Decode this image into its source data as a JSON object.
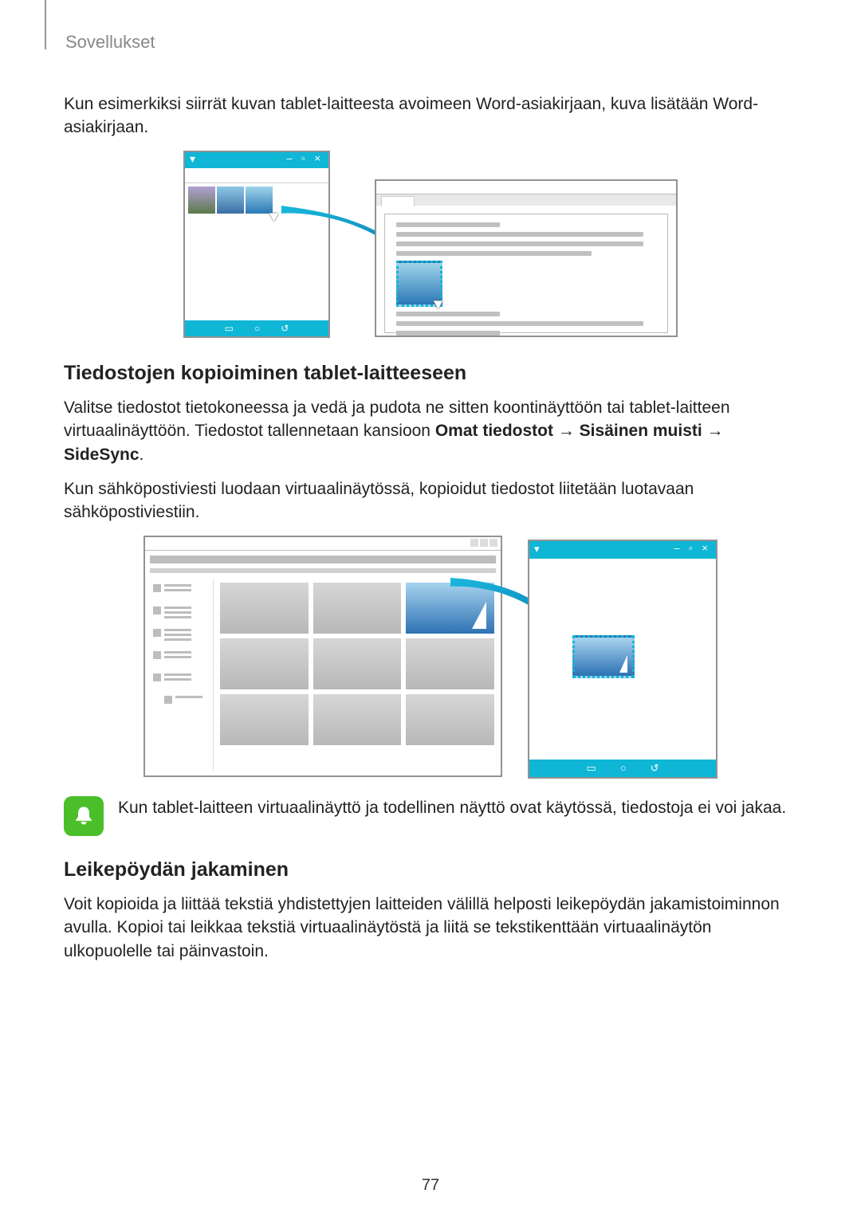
{
  "section": "Sovellukset",
  "intro": "Kun esimerkiksi siirrät kuvan tablet-laitteesta avoimeen Word-asiakirjaan, kuva lisätään Word-asiakirjaan.",
  "h1": "Tiedostojen kopioiminen tablet-laitteeseen",
  "p1a": "Valitse tiedostot tietokoneessa ja vedä ja pudota ne sitten koontinäyttöön tai tablet-laitteen virtuaalinäyttöön. Tiedostot tallennetaan kansioon ",
  "path1": "Omat tiedostot",
  "path2": "Sisäinen muisti",
  "path3": "SideSync",
  "p2": "Kun sähköpostiviesti luodaan virtuaalinäytössä, kopioidut tiedostot liitetään luotavaan sähköpostiviestiin.",
  "note": "Kun tablet-laitteen virtuaalinäyttö ja todellinen näyttö ovat käytössä, tiedostoja ei voi jakaa.",
  "h2": "Leikepöydän jakaminen",
  "p3": "Voit kopioida ja liittää tekstiä yhdistettyjen laitteiden välillä helposti leikepöydän jakamistoiminnon avulla. Kopioi tai leikkaa tekstiä virtuaalinäytöstä ja liitä se tekstikenttään virtuaalinäytön ulkopuolelle tai päinvastoin.",
  "page_number": "77"
}
